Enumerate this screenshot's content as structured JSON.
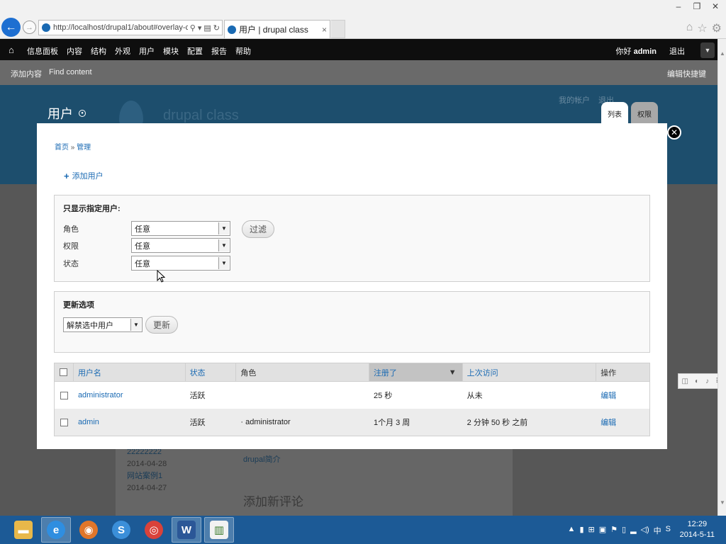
{
  "browser": {
    "url": "http://localhost/drupal1/about#overlay-cor",
    "tab_title": "用户 | drupal class",
    "tab_close": "×"
  },
  "toolbar": {
    "menu": [
      "信息面板",
      "内容",
      "结构",
      "外观",
      "用户",
      "模块",
      "配置",
      "报告",
      "帮助"
    ],
    "greeting": "你好",
    "username": "admin",
    "logout": "退出"
  },
  "shortcuts": {
    "items": [
      "添加内容",
      "Find content"
    ],
    "edit": "编辑快捷键"
  },
  "site": {
    "name": "drupal class",
    "secondary_links": [
      "我的帐户",
      "退出"
    ]
  },
  "page": {
    "title": "用户",
    "tabs": [
      "列表",
      "权限"
    ]
  },
  "overlay": {
    "breadcrumb": [
      "首页",
      "管理"
    ],
    "breadcrumb_sep": "»",
    "add_user": "添加用户",
    "filter": {
      "legend": "只显示指定用户:",
      "rows": [
        {
          "label": "角色",
          "value": "任意"
        },
        {
          "label": "权限",
          "value": "任意"
        },
        {
          "label": "状态",
          "value": "任意"
        }
      ],
      "button": "过滤"
    },
    "update": {
      "legend": "更新选项",
      "value": "解禁选中用户",
      "button": "更新"
    },
    "table": {
      "headers": [
        "用户名",
        "状态",
        "角色",
        "注册了",
        "上次访问",
        "操作"
      ],
      "rows": [
        {
          "username": "administrator",
          "status": "活跃",
          "roles": "",
          "registered": "25 秒",
          "last_access": "从未",
          "action": "编辑"
        },
        {
          "username": "admin",
          "status": "活跃",
          "roles": "· administrator",
          "registered": "1个月 3 周",
          "last_access": "2 分钟 50 秒 之前",
          "action": "编辑"
        }
      ]
    }
  },
  "background": {
    "left_lines": [
      "22222222",
      "2014-04-28",
      "网站案例1",
      "2014-04-27"
    ],
    "mid_link": "drupal简介",
    "heading": "添加新评论"
  },
  "taskbar": {
    "time": "12:29",
    "date": "2014-5-11",
    "ime": "中"
  }
}
